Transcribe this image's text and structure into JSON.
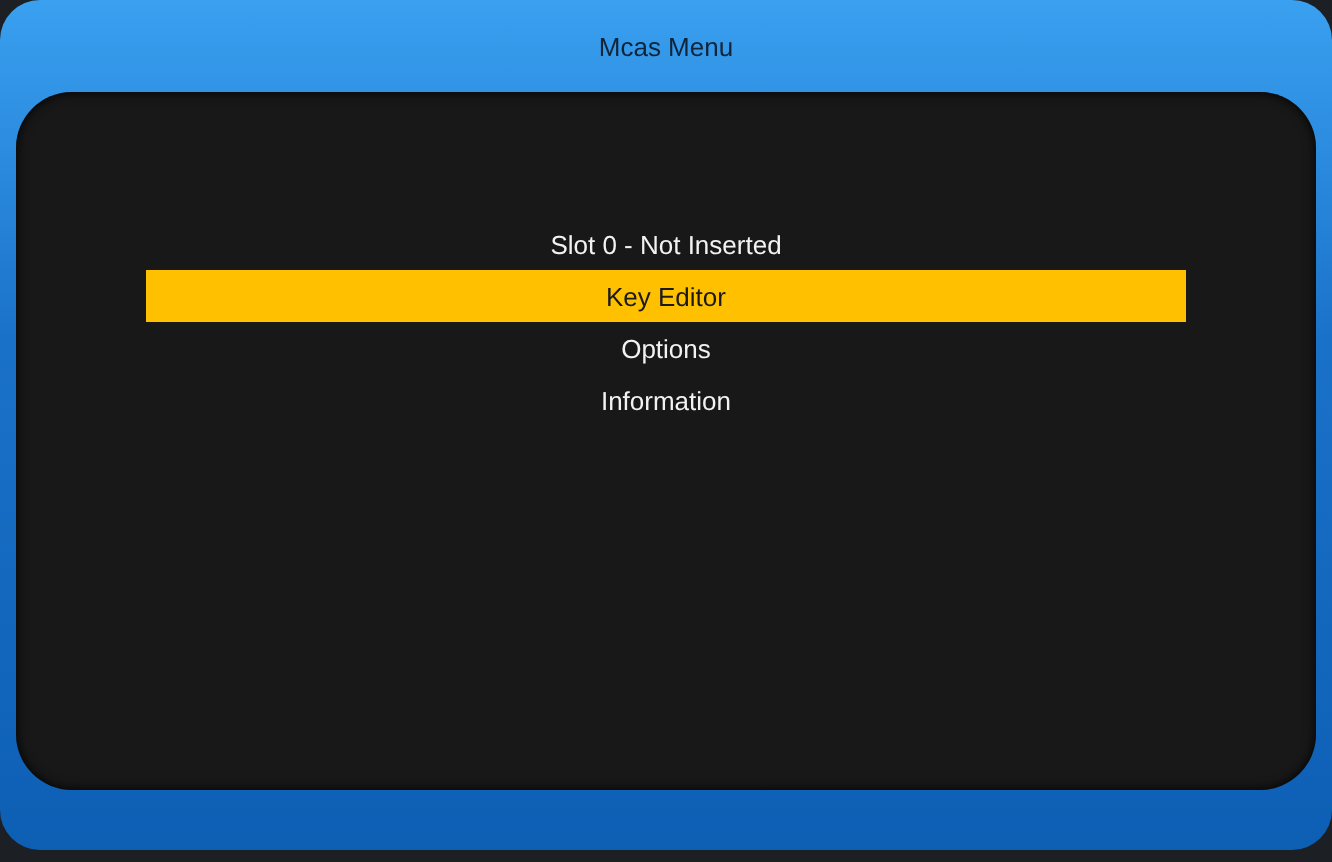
{
  "window": {
    "title": "Mcas Menu"
  },
  "menu": [
    {
      "label": "Slot 0 - Not Inserted",
      "selected": false
    },
    {
      "label": "Key Editor",
      "selected": true
    },
    {
      "label": "Options",
      "selected": false
    },
    {
      "label": "Information",
      "selected": false
    }
  ]
}
